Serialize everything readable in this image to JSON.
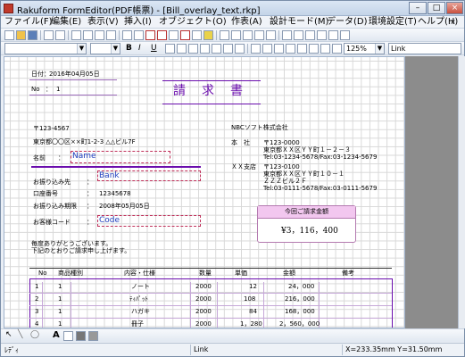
{
  "window": {
    "title": "Rakuform FormEditor(PDF帳票) - [Bill_overlay_text.rkp]"
  },
  "window_buttons": {
    "min": "–",
    "max": "□",
    "close": "×"
  },
  "menu": [
    "ファイル(F)",
    "編集(E)",
    "表示(V)",
    "挿入(I)",
    "オブジェクト(O)",
    "作表(A)",
    "設計モード(M)",
    "データ(D)",
    "環境設定(T)",
    "ヘルプ(H)"
  ],
  "mdi_buttons": {
    "min": "–",
    "restore": "❐",
    "close": "×"
  },
  "toolbar2": {
    "bold": "B",
    "italic": "I",
    "underline": "U",
    "zoom": "125%",
    "link": "Link"
  },
  "doc": {
    "date_label": "日付：",
    "date_value": "2016年04月05日",
    "no_label": "No",
    "no_sep": "：",
    "no_value": "1",
    "title": "請　求　書",
    "postal": "〒123-4567",
    "address": "東京都〇〇区××町1-2-3 △△ビル7F",
    "name_label": "名前",
    "name_sep": "：",
    "name_field": "Name",
    "bank_label": "お振り込み先",
    "bank_sep": "：",
    "bank_field": "Bank",
    "account_label": "口座番号",
    "account_sep": "：",
    "account_value": "12345678",
    "deadline_label": "お振り込み期限",
    "deadline_sep": "：",
    "deadline_value": "2008年05月05日",
    "code_label": "お客様コード",
    "code_sep": "：",
    "code_field": "Code",
    "thanks_1": "毎度ありがとうございます。",
    "thanks_2": "下記のとおりご請求申し上げます。",
    "company": "NBCソフト株式会社",
    "hq_label": "本　社",
    "hq_postal": "〒123-0000",
    "hq_address": "東京都ＸＸ区ＹＹ町１－２－３",
    "hq_tel": "Tel:03-1234-5678/Fax:03-1234-5679",
    "branch_label": "ＸＸ支店",
    "branch_postal": "〒123-0100",
    "branch_address_1": "東京都ＸＸ区ＹＹ町１０－１",
    "branch_address_2": "ＺＺＺビル２Ｆ",
    "branch_tel": "Tel:03-0111-5678/Fax:03-0111-5679",
    "amount_header": "今回ご請求金額",
    "amount_value": "¥3，116，400"
  },
  "table": {
    "headers": [
      "No",
      "商品種別",
      "内容・仕様",
      "数量",
      "単価",
      "金額",
      "備考"
    ],
    "rows": [
      {
        "no": "1",
        "type": "1",
        "desc": "ノート",
        "qty": "2000",
        "price": "12",
        "amount": "24，000"
      },
      {
        "no": "2",
        "type": "1",
        "desc": "ﾃｨﾊﾟｯﾄ",
        "qty": "2000",
        "price": "108",
        "amount": "216，000"
      },
      {
        "no": "3",
        "type": "1",
        "desc": "ハガキ",
        "qty": "2000",
        "price": "84",
        "amount": "168，000"
      },
      {
        "no": "4",
        "type": "1",
        "desc": "冊子",
        "qty": "2000",
        "price": "1，280",
        "amount": "2，560，000"
      }
    ]
  },
  "bottom_toolbar": {
    "text_tool": "A"
  },
  "status": {
    "left": "ﾚﾃﾞｨ",
    "mid": "Link",
    "coords": "X=233.35mm Y=31.50mm"
  },
  "colors": {
    "accent": "#6a0dad",
    "amount_box": "#f2c7ef",
    "grid": "#d8d8d8"
  }
}
